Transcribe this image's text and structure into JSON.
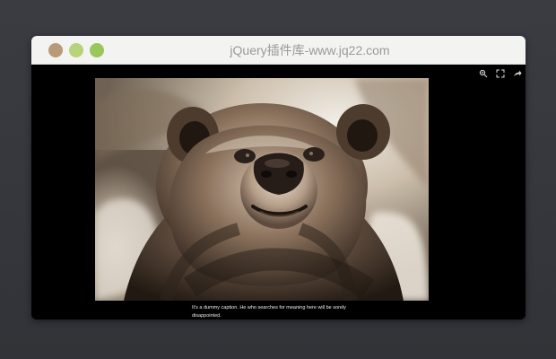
{
  "app": {
    "window_title": "jQuery插件库-www.jq22.com"
  },
  "viewer": {
    "caption": "It's a dummy caption. He who searches for meaning here will be sorely disappointed.",
    "toolbar": {
      "zoom_icon": "zoom-icon",
      "fullscreen_icon": "fullscreen-icon",
      "share_icon": "share-icon"
    },
    "image_subject": "bear"
  },
  "colors": {
    "background": "#34363b",
    "window_bar": "#f3f3f1",
    "viewer": "#000000",
    "dot_one": "#b89a79",
    "dot_two": "#b7d37a",
    "dot_three": "#99c75b"
  }
}
